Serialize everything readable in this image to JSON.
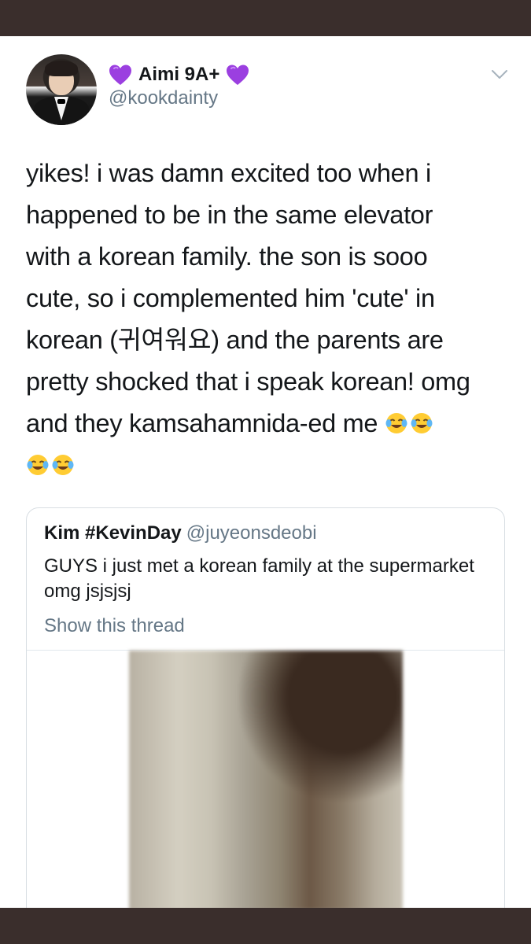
{
  "author": {
    "display_name": "Aimi 9A+",
    "handle": "@kookdainty",
    "avatar_icon": "profile-photo",
    "name_icons": [
      "purple-heart-icon",
      "purple-heart-icon"
    ]
  },
  "tweet": {
    "lines": [
      "yikes! i was damn excited too when i",
      "happened to be in the same elevator",
      "with a korean family. the son is sooo",
      "cute, so i complemented him 'cute' in",
      "korean (귀여워요) and the parents are",
      "pretty shocked that i speak korean! omg",
      "and they kamsahamnida-ed me"
    ],
    "emoji": "face-with-tears-of-joy-icon"
  },
  "quoted": {
    "display_name": "Kim #KevinDay",
    "handle": "@juyeonsdeobi",
    "text": "GUYS i just met a korean family at the supermarket omg jsjsjsj",
    "show_thread_label": "Show this thread",
    "media_icon": "video-thumbnail"
  },
  "colors": {
    "frame_bar": "#3a2e2c",
    "heart": "#9b3fe0",
    "secondary_text": "#657786",
    "border": "#d8dee3"
  }
}
